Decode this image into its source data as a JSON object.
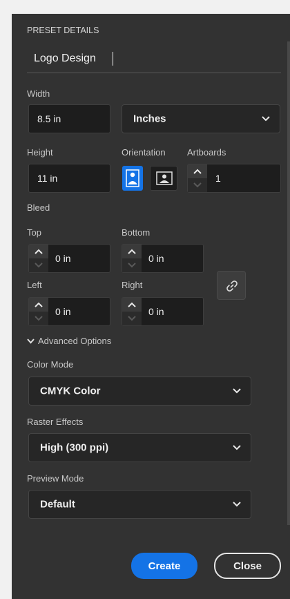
{
  "section_title": "PRESET DETAILS",
  "preset_name": "Logo Design",
  "width": {
    "label": "Width",
    "value": "8.5 in",
    "units": "Inches"
  },
  "height": {
    "label": "Height",
    "value": "11 in"
  },
  "orientation": {
    "label": "Orientation",
    "selected": "portrait"
  },
  "artboards": {
    "label": "Artboards",
    "value": "1"
  },
  "bleed": {
    "label": "Bleed",
    "top": {
      "label": "Top",
      "value": "0 in"
    },
    "bottom": {
      "label": "Bottom",
      "value": "0 in"
    },
    "left": {
      "label": "Left",
      "value": "0 in"
    },
    "right": {
      "label": "Right",
      "value": "0 in"
    },
    "link_icon": "link-icon"
  },
  "advanced": {
    "label": "Advanced Options",
    "expanded": true
  },
  "color_mode": {
    "label": "Color Mode",
    "value": "CMYK Color"
  },
  "raster_effects": {
    "label": "Raster Effects",
    "value": "High (300 ppi)"
  },
  "preview_mode": {
    "label": "Preview Mode",
    "value": "Default"
  },
  "buttons": {
    "create": "Create",
    "close": "Close"
  },
  "colors": {
    "panel": "#323232",
    "accent": "#1473e6",
    "field": "#1d1d1d"
  }
}
